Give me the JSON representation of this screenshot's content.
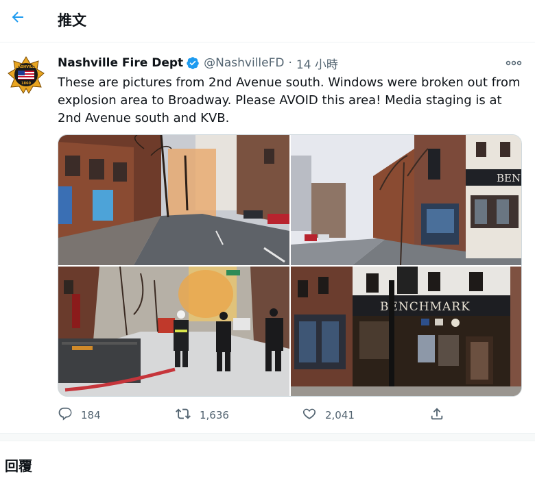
{
  "header": {
    "back_icon": "arrow-left-icon",
    "title": "推文",
    "accent_color": "#1d9bf0"
  },
  "tweet": {
    "author_name": "Nashville Fire Dept",
    "verified_icon": "verified-badge-icon",
    "handle": "@NashvilleFD",
    "separator": "·",
    "time": "14 小時",
    "more_icon": "more-options-icon",
    "text": "These are pictures from 2nd Avenue south. Windows were broken out from explosion area to Broadway.  Please AVOID this area! Media staging is at 2nd Avenue south and KVB.",
    "avatar": {
      "logo_text_top": "NASHVILLE",
      "logo_text_bottom": "1860"
    },
    "media": {
      "photo4_sign_text": "BENCHMARK",
      "photo2_sign_text": "BEN"
    },
    "actions": {
      "reply_icon": "reply-icon",
      "reply_count": "184",
      "retweet_icon": "retweet-icon",
      "retweet_count": "1,636",
      "like_icon": "like-icon",
      "like_count": "2,041",
      "share_icon": "share-icon"
    }
  },
  "replies": {
    "heading": "回覆"
  }
}
